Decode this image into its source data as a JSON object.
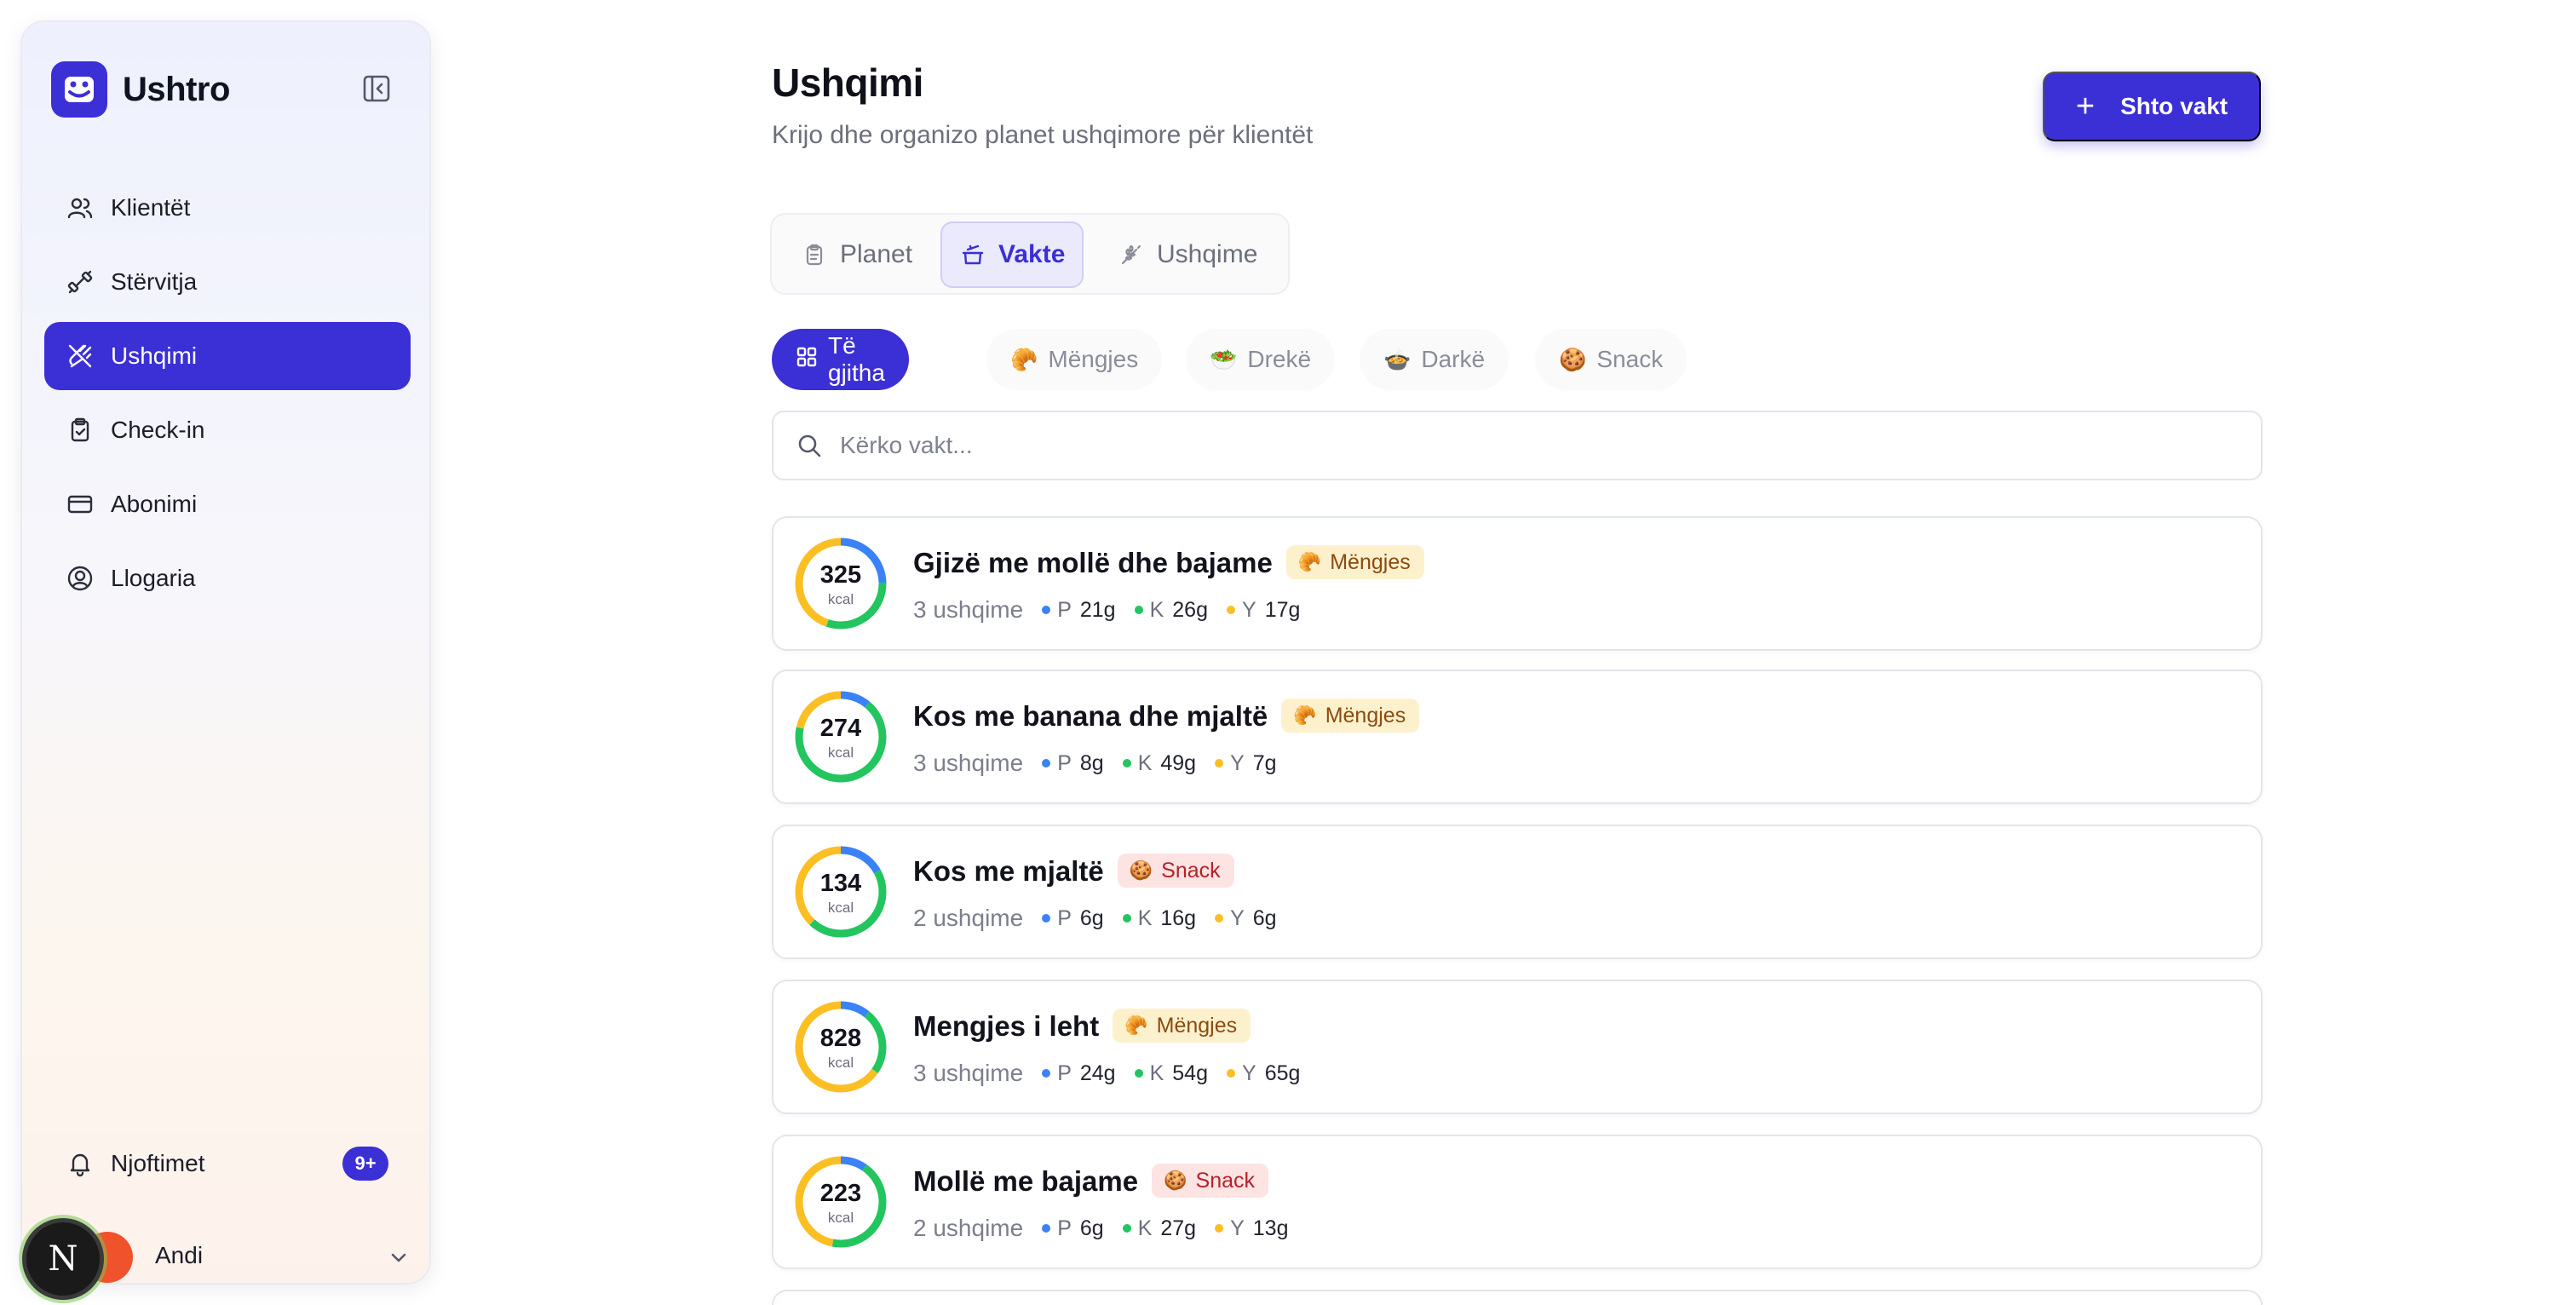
{
  "app": {
    "name": "Ushtro"
  },
  "sidebar": {
    "items": [
      {
        "label": "Klientët",
        "icon": "users-icon",
        "active": false
      },
      {
        "label": "Stërvitja",
        "icon": "dumbbell-icon",
        "active": false
      },
      {
        "label": "Ushqimi",
        "icon": "utensils-crossed-icon",
        "active": true
      },
      {
        "label": "Check-in",
        "icon": "clipboard-check-icon",
        "active": false
      },
      {
        "label": "Abonimi",
        "icon": "credit-card-icon",
        "active": false
      },
      {
        "label": "Llogaria",
        "icon": "user-circle-icon",
        "active": false
      }
    ],
    "notifications": {
      "label": "Njoftimet",
      "badge": "9+"
    },
    "user": {
      "name": "Andi",
      "dev_badge": "N"
    }
  },
  "header": {
    "title": "Ushqimi",
    "subtitle": "Krijo dhe organizo planet ushqimore për klientët",
    "add_button": "Shto vakt"
  },
  "tabs": [
    {
      "label": "Planet",
      "icon": "clipboard-icon",
      "active": false
    },
    {
      "label": "Vakte",
      "icon": "cooking-pot-icon",
      "active": true
    },
    {
      "label": "Ushqime",
      "icon": "wheat-icon",
      "active": false
    }
  ],
  "filters": [
    {
      "label": "Të gjitha",
      "emoji": "grid-icon",
      "active": true
    },
    {
      "label": "Mëngjes",
      "emoji": "🥐",
      "active": false
    },
    {
      "label": "Drekë",
      "emoji": "🥗",
      "active": false
    },
    {
      "label": "Darkë",
      "emoji": "🍲",
      "active": false
    },
    {
      "label": "Snack",
      "emoji": "🍪",
      "active": false
    }
  ],
  "search": {
    "placeholder": "Kërko vakt..."
  },
  "macro_labels": {
    "protein": "P",
    "carbs": "K",
    "fat": "Y"
  },
  "colors": {
    "accent": "#3b2fd6",
    "protein": "#3b82f6",
    "carbs": "#22c55e",
    "fat": "#fbbf24"
  },
  "meals": [
    {
      "name": "Gjizë me mollë dhe bajame",
      "kcal": "325",
      "unit": "kcal",
      "tag": "Mëngjes",
      "tag_emoji": "🥐",
      "tag_type": "breakfast",
      "count": "3 ushqime",
      "p": "21g",
      "k": "26g",
      "y": "17g",
      "pv": 21,
      "kv": 26,
      "yv": 17
    },
    {
      "name": "Kos me banana dhe mjaltë",
      "kcal": "274",
      "unit": "kcal",
      "tag": "Mëngjes",
      "tag_emoji": "🥐",
      "tag_type": "breakfast",
      "count": "3 ushqime",
      "p": "8g",
      "k": "49g",
      "y": "7g",
      "pv": 8,
      "kv": 49,
      "yv": 7
    },
    {
      "name": "Kos me mjaltë",
      "kcal": "134",
      "unit": "kcal",
      "tag": "Snack",
      "tag_emoji": "🍪",
      "tag_type": "snack",
      "count": "2 ushqime",
      "p": "6g",
      "k": "16g",
      "y": "6g",
      "pv": 6,
      "kv": 16,
      "yv": 6
    },
    {
      "name": "Mengjes i leht",
      "kcal": "828",
      "unit": "kcal",
      "tag": "Mëngjes",
      "tag_emoji": "🥐",
      "tag_type": "breakfast",
      "count": "3 ushqime",
      "p": "24g",
      "k": "54g",
      "y": "65g",
      "pv": 24,
      "kv": 54,
      "yv": 65
    },
    {
      "name": "Mollë me bajame",
      "kcal": "223",
      "unit": "kcal",
      "tag": "Snack",
      "tag_emoji": "🍪",
      "tag_type": "snack",
      "count": "2 ushqime",
      "p": "6g",
      "k": "27g",
      "y": "13g",
      "pv": 6,
      "kv": 27,
      "yv": 13
    }
  ]
}
